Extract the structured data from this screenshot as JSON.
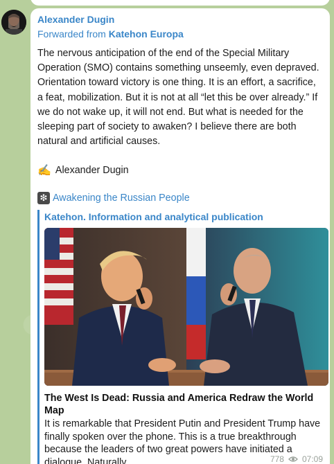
{
  "message": {
    "sender": "Alexander Dugin",
    "forwarded_prefix": "Forwarded from",
    "forwarded_source": "Katehon Europa",
    "body": "The nervous anticipation of the end of the Special Military Operation (SMO) contains something unseemly, even depraved. Orientation toward victory is one thing. It is an effort, a sacrifice, a feat, mobilization. But it is not at all “let this be over already.” If we do not wake up, it will not end. But what is needed for the sleeping part of society to awaken? I believe there are both natural and artificial causes.",
    "signature_emoji": "✍️",
    "signature": "Alexander Dugin",
    "channel_emoji": "❇",
    "channel_link": "Awakening the Russian People"
  },
  "link_preview": {
    "site_name": "Katehon. Information and analytical publication",
    "title": "The West Is Dead: Russia and America Redraw the World Map",
    "description": "It is remarkable that President Putin and President Trump have finally spoken over the phone. This is a true breakthrough because the leaders of two great powers have initiated a dialogue. Naturally,"
  },
  "meta": {
    "views": "778",
    "time": "07:09"
  },
  "colors": {
    "accent": "#3a86c8",
    "chat_background": "#b7cf9c",
    "bubble": "#ffffff"
  },
  "icons": [
    "eye-icon",
    "writing-hand-icon",
    "channel-emoji-icon"
  ]
}
